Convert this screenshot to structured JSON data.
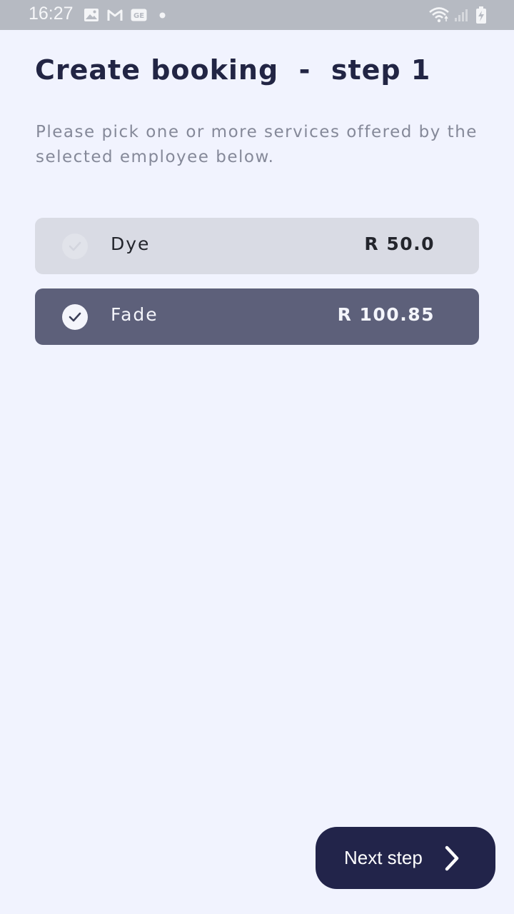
{
  "status_bar": {
    "time": "16:27",
    "icons": [
      "image-icon",
      "gmail-icon",
      "ge-icon",
      "notification-dot-icon",
      "wifi-icon",
      "signal-icon",
      "battery-charging-icon"
    ]
  },
  "page": {
    "title": "Create booking  -  step 1",
    "description": "Please pick one or more services offered by the selected employee below."
  },
  "services": [
    {
      "name": "Dye",
      "price": "R 50.0",
      "selected": false
    },
    {
      "name": "Fade",
      "price": "R 100.85",
      "selected": true
    }
  ],
  "next_button": {
    "label": "Next step",
    "icon": "chevron-right-icon"
  },
  "colors": {
    "background": "#f1f3fe",
    "status_bar": "#b6bac2",
    "title": "#222544",
    "description": "#858999",
    "service_unselected": "#d9dbe4",
    "service_selected": "#5d607a",
    "button": "#22244a"
  }
}
